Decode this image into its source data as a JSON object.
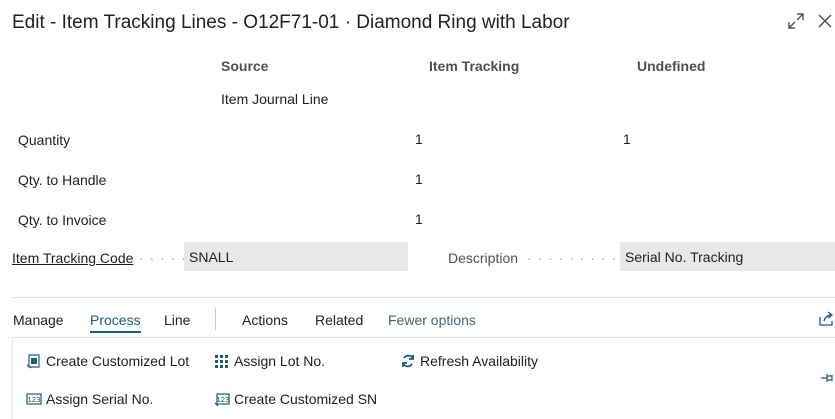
{
  "window": {
    "title": "Edit - Item Tracking Lines - O12F71-01 · Diamond Ring with Labor"
  },
  "columns": {
    "source": "Source",
    "item_tracking": "Item Tracking",
    "undefined": "Undefined",
    "source_sub": "Item Journal Line"
  },
  "rows": [
    {
      "label": "Quantity",
      "item_tracking": "1",
      "undefined": "1"
    },
    {
      "label": "Qty. to Handle",
      "item_tracking": "1",
      "undefined": ""
    },
    {
      "label": "Qty. to Invoice",
      "item_tracking": "1",
      "undefined": ""
    }
  ],
  "fields": {
    "item_tracking_code_label": "Item Tracking Code",
    "item_tracking_code_value": "SNALL",
    "description_label": "Description",
    "description_value": "Serial No. Tracking"
  },
  "action_bar": {
    "manage": "Manage",
    "process": "Process",
    "line": "Line",
    "actions": "Actions",
    "related": "Related",
    "fewer_options": "Fewer options"
  },
  "commands": {
    "create_customized_lot": "Create Customized Lot",
    "assign_lot_no": "Assign Lot No.",
    "refresh_availability": "Refresh Availability",
    "assign_serial_no": "Assign Serial No.",
    "create_customized_sn": "Create Customized SN"
  },
  "icons": {
    "expand": "expand-icon",
    "close": "close-icon",
    "share": "share-icon",
    "pin": "pin-icon",
    "accent_color": "#1a5d75"
  }
}
